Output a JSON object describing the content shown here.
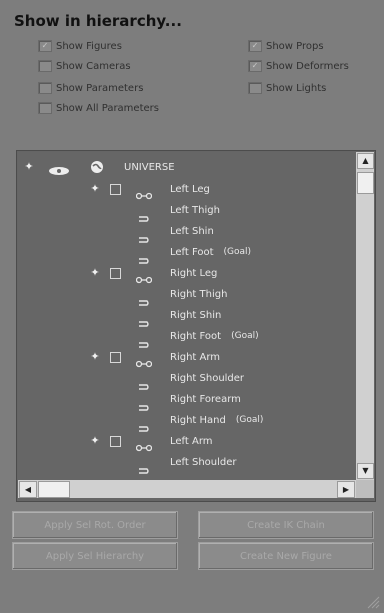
{
  "header": {
    "title": "Show in hierarchy..."
  },
  "options": {
    "show_figures": {
      "label": "Show Figures",
      "checked": true
    },
    "show_cameras": {
      "label": "Show Cameras",
      "checked": false
    },
    "show_parameters": {
      "label": "Show Parameters",
      "checked": false
    },
    "show_all_parameters": {
      "label": "Show All Parameters",
      "checked": false
    },
    "show_props": {
      "label": "Show Props",
      "checked": true
    },
    "show_deformers": {
      "label": "Show Deformers",
      "checked": true
    },
    "show_lights": {
      "label": "Show Lights",
      "checked": false
    }
  },
  "tree": {
    "root": {
      "label": "UNIVERSE",
      "icon": "globe-icon"
    },
    "nodes": [
      {
        "label": "Left Leg",
        "type": "chain",
        "goal": ""
      },
      {
        "label": "Left Thigh",
        "type": "bone",
        "goal": ""
      },
      {
        "label": "Left Shin",
        "type": "bone",
        "goal": ""
      },
      {
        "label": "Left Foot",
        "type": "bone",
        "goal": "(Goal)"
      },
      {
        "label": "Right Leg",
        "type": "chain",
        "goal": ""
      },
      {
        "label": "Right Thigh",
        "type": "bone",
        "goal": ""
      },
      {
        "label": "Right Shin",
        "type": "bone",
        "goal": ""
      },
      {
        "label": "Right Foot",
        "type": "bone",
        "goal": "(Goal)"
      },
      {
        "label": "Right Arm",
        "type": "chain",
        "goal": ""
      },
      {
        "label": "Right Shoulder",
        "type": "bone",
        "goal": ""
      },
      {
        "label": "Right Forearm",
        "type": "bone",
        "goal": ""
      },
      {
        "label": "Right Hand",
        "type": "bone",
        "goal": "(Goal)"
      },
      {
        "label": "Left Arm",
        "type": "chain",
        "goal": ""
      },
      {
        "label": "Left Shoulder",
        "type": "bone",
        "goal": ""
      }
    ]
  },
  "buttons": {
    "apply_sel_rot_order": "Apply Sel Rot. Order",
    "create_ik_chain": "Create IK Chain",
    "apply_sel_hierarchy": "Apply Sel Hierarchy",
    "create_new_figure": "Create New Figure"
  },
  "colors": {
    "panel_bg": "#7d7d7d",
    "tree_bg": "#666666",
    "tree_text": "#e8e8e8",
    "disabled_text": "#a9a9a9"
  }
}
